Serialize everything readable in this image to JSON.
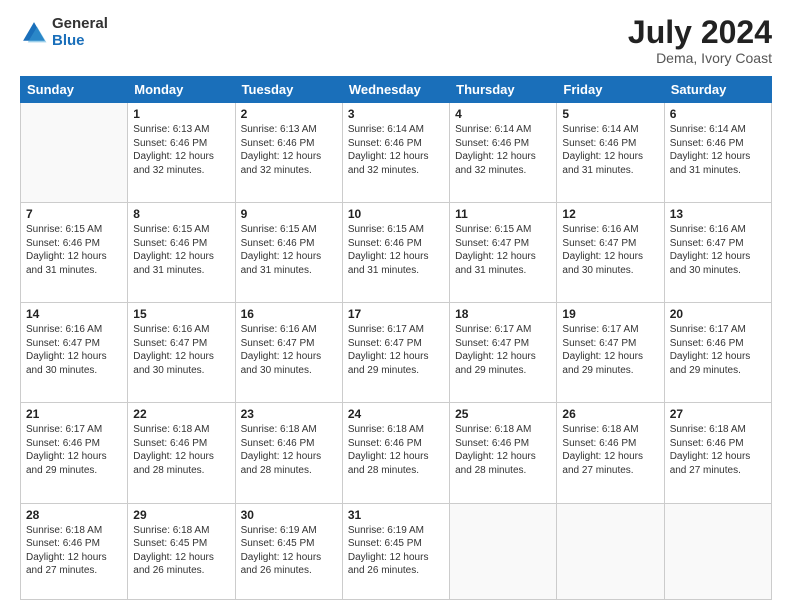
{
  "header": {
    "logo_general": "General",
    "logo_blue": "Blue",
    "month_year": "July 2024",
    "location": "Dema, Ivory Coast"
  },
  "days_of_week": [
    "Sunday",
    "Monday",
    "Tuesday",
    "Wednesday",
    "Thursday",
    "Friday",
    "Saturday"
  ],
  "weeks": [
    [
      {
        "day": "",
        "info": ""
      },
      {
        "day": "1",
        "info": "Sunrise: 6:13 AM\nSunset: 6:46 PM\nDaylight: 12 hours\nand 32 minutes."
      },
      {
        "day": "2",
        "info": "Sunrise: 6:13 AM\nSunset: 6:46 PM\nDaylight: 12 hours\nand 32 minutes."
      },
      {
        "day": "3",
        "info": "Sunrise: 6:14 AM\nSunset: 6:46 PM\nDaylight: 12 hours\nand 32 minutes."
      },
      {
        "day": "4",
        "info": "Sunrise: 6:14 AM\nSunset: 6:46 PM\nDaylight: 12 hours\nand 32 minutes."
      },
      {
        "day": "5",
        "info": "Sunrise: 6:14 AM\nSunset: 6:46 PM\nDaylight: 12 hours\nand 31 minutes."
      },
      {
        "day": "6",
        "info": "Sunrise: 6:14 AM\nSunset: 6:46 PM\nDaylight: 12 hours\nand 31 minutes."
      }
    ],
    [
      {
        "day": "7",
        "info": ""
      },
      {
        "day": "8",
        "info": "Sunrise: 6:15 AM\nSunset: 6:46 PM\nDaylight: 12 hours\nand 31 minutes."
      },
      {
        "day": "9",
        "info": "Sunrise: 6:15 AM\nSunset: 6:46 PM\nDaylight: 12 hours\nand 31 minutes."
      },
      {
        "day": "10",
        "info": "Sunrise: 6:15 AM\nSunset: 6:46 PM\nDaylight: 12 hours\nand 31 minutes."
      },
      {
        "day": "11",
        "info": "Sunrise: 6:15 AM\nSunset: 6:47 PM\nDaylight: 12 hours\nand 31 minutes."
      },
      {
        "day": "12",
        "info": "Sunrise: 6:16 AM\nSunset: 6:47 PM\nDaylight: 12 hours\nand 30 minutes."
      },
      {
        "day": "13",
        "info": "Sunrise: 6:16 AM\nSunset: 6:47 PM\nDaylight: 12 hours\nand 30 minutes."
      }
    ],
    [
      {
        "day": "14",
        "info": ""
      },
      {
        "day": "15",
        "info": "Sunrise: 6:16 AM\nSunset: 6:47 PM\nDaylight: 12 hours\nand 30 minutes."
      },
      {
        "day": "16",
        "info": "Sunrise: 6:16 AM\nSunset: 6:47 PM\nDaylight: 12 hours\nand 30 minutes."
      },
      {
        "day": "17",
        "info": "Sunrise: 6:17 AM\nSunset: 6:47 PM\nDaylight: 12 hours\nand 29 minutes."
      },
      {
        "day": "18",
        "info": "Sunrise: 6:17 AM\nSunset: 6:47 PM\nDaylight: 12 hours\nand 29 minutes."
      },
      {
        "day": "19",
        "info": "Sunrise: 6:17 AM\nSunset: 6:47 PM\nDaylight: 12 hours\nand 29 minutes."
      },
      {
        "day": "20",
        "info": "Sunrise: 6:17 AM\nSunset: 6:46 PM\nDaylight: 12 hours\nand 29 minutes."
      }
    ],
    [
      {
        "day": "21",
        "info": ""
      },
      {
        "day": "22",
        "info": "Sunrise: 6:18 AM\nSunset: 6:46 PM\nDaylight: 12 hours\nand 28 minutes."
      },
      {
        "day": "23",
        "info": "Sunrise: 6:18 AM\nSunset: 6:46 PM\nDaylight: 12 hours\nand 28 minutes."
      },
      {
        "day": "24",
        "info": "Sunrise: 6:18 AM\nSunset: 6:46 PM\nDaylight: 12 hours\nand 28 minutes."
      },
      {
        "day": "25",
        "info": "Sunrise: 6:18 AM\nSunset: 6:46 PM\nDaylight: 12 hours\nand 28 minutes."
      },
      {
        "day": "26",
        "info": "Sunrise: 6:18 AM\nSunset: 6:46 PM\nDaylight: 12 hours\nand 27 minutes."
      },
      {
        "day": "27",
        "info": "Sunrise: 6:18 AM\nSunset: 6:46 PM\nDaylight: 12 hours\nand 27 minutes."
      }
    ],
    [
      {
        "day": "28",
        "info": "Sunrise: 6:18 AM\nSunset: 6:46 PM\nDaylight: 12 hours\nand 27 minutes."
      },
      {
        "day": "29",
        "info": "Sunrise: 6:18 AM\nSunset: 6:45 PM\nDaylight: 12 hours\nand 26 minutes."
      },
      {
        "day": "30",
        "info": "Sunrise: 6:19 AM\nSunset: 6:45 PM\nDaylight: 12 hours\nand 26 minutes."
      },
      {
        "day": "31",
        "info": "Sunrise: 6:19 AM\nSunset: 6:45 PM\nDaylight: 12 hours\nand 26 minutes."
      },
      {
        "day": "",
        "info": ""
      },
      {
        "day": "",
        "info": ""
      },
      {
        "day": "",
        "info": ""
      }
    ]
  ],
  "week7_sunday_info": "Sunrise: 6:15 AM\nSunset: 6:46 PM\nDaylight: 12 hours\nand 31 minutes.",
  "week14_sunday_info": "Sunrise: 6:16 AM\nSunset: 6:47 PM\nDaylight: 12 hours\nand 30 minutes.",
  "week21_sunday_info": "Sunrise: 6:17 AM\nSunset: 6:46 PM\nDaylight: 12 hours\nand 29 minutes."
}
